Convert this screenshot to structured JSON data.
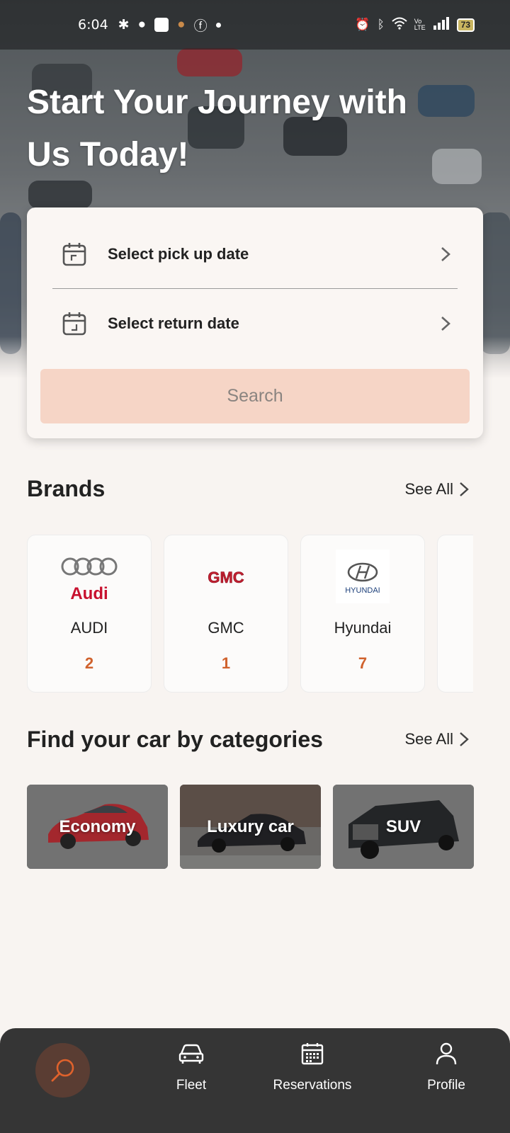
{
  "status_bar": {
    "time": "6:04",
    "battery": "73"
  },
  "hero": {
    "title_line1": "Start Your Journey with",
    "title_line2": "Us Today!"
  },
  "booking": {
    "pickup_label": "Select pick up date",
    "return_label": "Select return date",
    "search_label": "Search"
  },
  "brands": {
    "title": "Brands",
    "see_all": "See All",
    "items": [
      {
        "name": "AUDI",
        "count": "2",
        "logo_text": "Audi"
      },
      {
        "name": "GMC",
        "count": "1",
        "logo_text": "GMC"
      },
      {
        "name": "Hyundai",
        "count": "7",
        "logo_text": "HYUNDAI"
      }
    ]
  },
  "categories": {
    "title": "Find your car by categories",
    "see_all": "See All",
    "items": [
      {
        "label": "Economy"
      },
      {
        "label": "Luxury car"
      },
      {
        "label": "SUV"
      }
    ]
  },
  "nav": {
    "items": [
      {
        "label": "",
        "icon": "search-icon",
        "active": true
      },
      {
        "label": "Fleet",
        "icon": "car-icon"
      },
      {
        "label": "Reservations",
        "icon": "calendar-icon"
      },
      {
        "label": "Profile",
        "icon": "person-icon"
      }
    ]
  },
  "colors": {
    "accent": "#d0622d",
    "search_button_bg": "#f6d5c6",
    "nav_bg": "#353535"
  }
}
